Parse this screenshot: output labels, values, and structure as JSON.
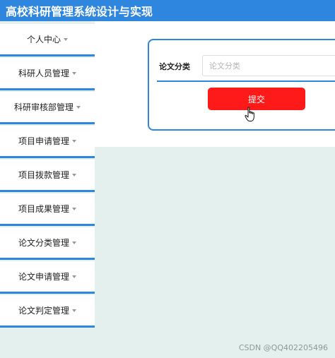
{
  "header": {
    "title": "高校科研管理系统设计与实现"
  },
  "sidebar": {
    "items": [
      {
        "label": "个人中心"
      },
      {
        "label": "科研人员管理"
      },
      {
        "label": "科研审核部管理"
      },
      {
        "label": "项目申请管理"
      },
      {
        "label": "项目拨款管理"
      },
      {
        "label": "项目成果管理"
      },
      {
        "label": "论文分类管理"
      },
      {
        "label": "论文申请管理"
      },
      {
        "label": "论文判定管理"
      }
    ]
  },
  "form": {
    "label": "论文分类",
    "input_value": "",
    "input_placeholder": "论文分类",
    "submit_label": "提交"
  },
  "watermark": {
    "text": "CSDN @QQ402205496"
  },
  "colors": {
    "header": "#2e86de",
    "accent": "#2e86de",
    "submit": "#ff1a1a",
    "background": "#e4f0ee"
  }
}
